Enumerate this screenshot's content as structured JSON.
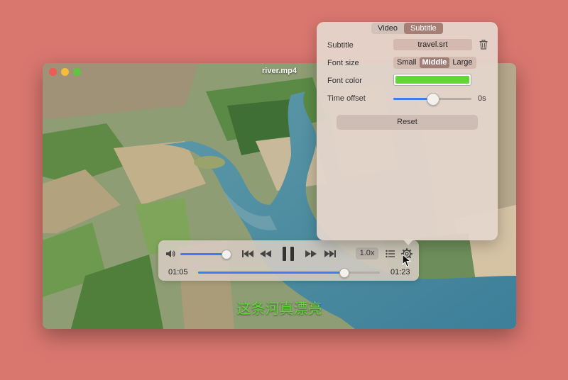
{
  "window": {
    "title": "river.mp4",
    "subtitle_line": "这条河真漂亮"
  },
  "controls": {
    "volume_level": 0.97,
    "speed_label": "1.0x",
    "current_time": "01:05",
    "total_time": "01:23",
    "progress": 0.8,
    "icons": [
      "speaker-icon",
      "skip-back-icon",
      "rewind-icon",
      "pause-icon",
      "fast-forward-icon",
      "skip-forward-icon",
      "playlist-icon",
      "gear-icon"
    ]
  },
  "settings_panel": {
    "tabs": [
      {
        "label": "Video",
        "active": false
      },
      {
        "label": "Subtitle",
        "active": true
      }
    ],
    "subtitle_label": "Subtitle",
    "subtitle_file": "travel.srt",
    "font_size_label": "Font size",
    "font_size_options": [
      "Small",
      "Middle",
      "Large"
    ],
    "font_size_selected": "Middle",
    "font_color_label": "Font color",
    "font_color": "#5fd832",
    "time_offset_label": "Time offset",
    "time_offset_value": "0s",
    "time_offset_level": 0.5,
    "reset_label": "Reset"
  },
  "colors": {
    "background": "#d9776f",
    "accent": "#3c7cf5",
    "subtitle_text": "#62d83a"
  }
}
